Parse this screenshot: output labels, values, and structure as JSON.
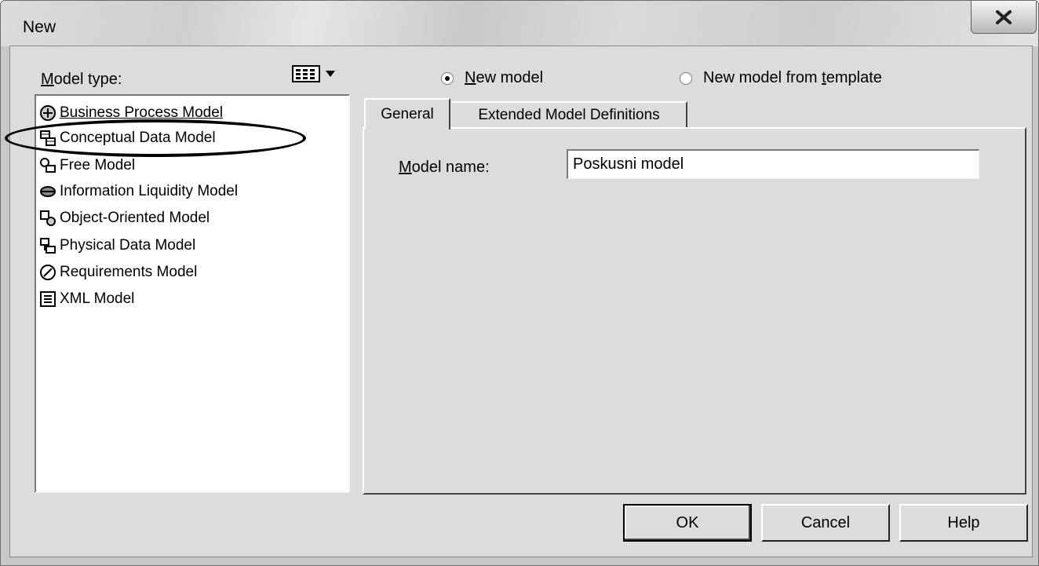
{
  "window": {
    "title": "New"
  },
  "left": {
    "model_type_label_first": "M",
    "model_type_label_rest": "odel type:",
    "items": [
      {
        "label": "Business Process Model",
        "icon": "business-process-icon"
      },
      {
        "label": "Conceptual Data Model",
        "icon": "conceptual-data-icon"
      },
      {
        "label": "Free Model",
        "icon": "free-model-icon"
      },
      {
        "label": "Information Liquidity Model",
        "icon": "information-liquidity-icon"
      },
      {
        "label": "Object-Oriented Model",
        "icon": "object-oriented-icon"
      },
      {
        "label": "Physical Data Model",
        "icon": "physical-data-icon"
      },
      {
        "label": "Requirements Model",
        "icon": "requirements-icon"
      },
      {
        "label": "XML Model",
        "icon": "xml-model-icon"
      }
    ]
  },
  "options": {
    "new_model_first": "N",
    "new_model_rest": "ew model",
    "from_template_a": "New model from ",
    "from_template_u": "t",
    "from_template_b": "emplate",
    "selected": "new_model"
  },
  "tabs": {
    "general": "General",
    "extended": "Extended Model Definitions"
  },
  "form": {
    "model_name_first": "M",
    "model_name_rest": "odel name:",
    "model_name_value": "Poskusni model"
  },
  "buttons": {
    "ok": "OK",
    "cancel": "Cancel",
    "help": "Help"
  }
}
